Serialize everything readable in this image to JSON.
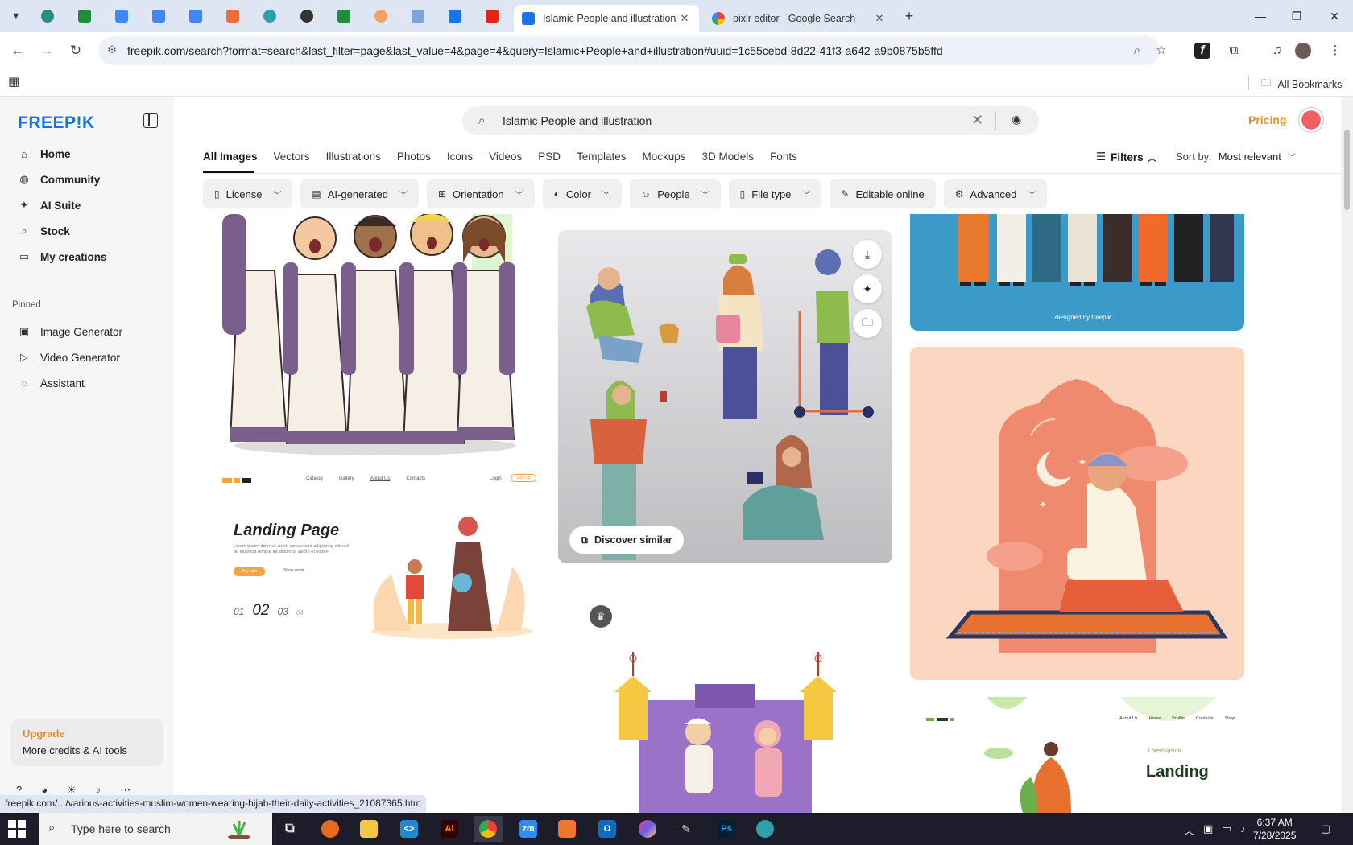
{
  "browser": {
    "tabs": [
      {
        "title": "Islamic People and illustration v",
        "active": true
      },
      {
        "title": "pixlr editor - Google Search",
        "active": false
      }
    ],
    "url": "freepik.com/search?format=search&last_filter=page&last_value=4&page=4&query=Islamic+People+and+illustration#uuid=1c55cebd-8d22-41f3-a642-a9b0875b5ffd",
    "all_bookmarks": "All Bookmarks",
    "status_url": "freepik.com/.../various-activities-muslim-women-wearing-hijab-their-daily-activities_21087365.htm"
  },
  "sidebar": {
    "logo": "FREEP!K",
    "items": [
      {
        "label": "Home",
        "icon": "home-icon"
      },
      {
        "label": "Community",
        "icon": "globe-icon"
      },
      {
        "label": "AI Suite",
        "icon": "sparkle-icon"
      },
      {
        "label": "Stock",
        "icon": "search-icon"
      },
      {
        "label": "My creations",
        "icon": "folder-icon"
      }
    ],
    "pinned_label": "Pinned",
    "pinned": [
      {
        "label": "Image Generator",
        "icon": "image-icon"
      },
      {
        "label": "Video Generator",
        "icon": "video-icon"
      },
      {
        "label": "Assistant",
        "icon": "chat-icon"
      }
    ],
    "upgrade": {
      "title": "Upgrade",
      "subtitle": "More credits & AI tools"
    }
  },
  "header": {
    "search_query": "Islamic People and illustration",
    "pricing": "Pricing"
  },
  "type_tabs": [
    "All Images",
    "Vectors",
    "Illustrations",
    "Photos",
    "Icons",
    "Videos",
    "PSD",
    "Templates",
    "Mockups",
    "3D Models",
    "Fonts"
  ],
  "filters_label": "Filters",
  "sort": {
    "label": "Sort by:",
    "value": "Most relevant"
  },
  "chips": [
    {
      "label": "License",
      "icon": "license-icon"
    },
    {
      "label": "AI-generated",
      "icon": "ai-icon"
    },
    {
      "label": "Orientation",
      "icon": "orientation-icon"
    },
    {
      "label": "Color",
      "icon": "palette-icon"
    },
    {
      "label": "People",
      "icon": "people-icon"
    },
    {
      "label": "File type",
      "icon": "file-icon"
    },
    {
      "label": "Editable online",
      "icon": "pen-icon"
    },
    {
      "label": "Advanced",
      "icon": "gear-icon"
    }
  ],
  "results": {
    "discover_similar": "Discover similar",
    "landing": {
      "nav": [
        "Catalog",
        "Gallery",
        "About Us",
        "Contacts"
      ],
      "login": "Login",
      "signup": "Sign Up",
      "title": "Landing Page",
      "body": "Lorem ipsum dolor sit amet, consectetur adipiscing elit sed do eiusmod tempor incididunt ut labore et dolore",
      "btn": "Buy now",
      "more": "Show more",
      "pages": [
        "01",
        "02",
        "03",
        "04"
      ]
    },
    "landing2": {
      "nav": [
        "About Us",
        "Home",
        "Profile",
        "Contacts",
        "Shop"
      ],
      "kicker": "Lorem ipsum",
      "title": "Landing"
    },
    "watermark": "designed by freepik"
  },
  "taskbar": {
    "search_placeholder": "Type here to search",
    "time": "6:37 AM",
    "date": "7/28/2025"
  }
}
